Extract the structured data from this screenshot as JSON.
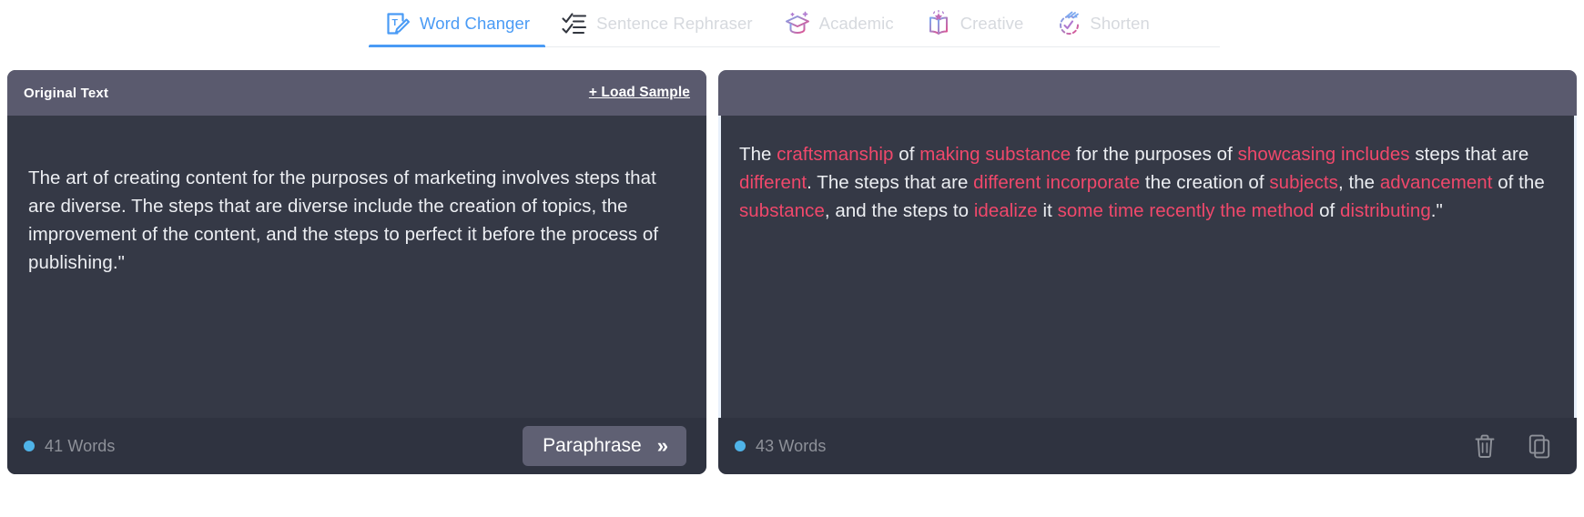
{
  "tabs": [
    {
      "id": "word-changer",
      "label": "Word Changer",
      "icon": "text-edit-icon",
      "active": true
    },
    {
      "id": "sentence-rephraser",
      "label": "Sentence Rephraser",
      "icon": "checklist-icon",
      "active": false
    },
    {
      "id": "academic",
      "label": "Academic",
      "icon": "graduation-cap-icon",
      "active": false
    },
    {
      "id": "creative",
      "label": "Creative",
      "icon": "open-book-icon",
      "active": false
    },
    {
      "id": "shorten",
      "label": "Shorten",
      "icon": "shorten-clock-icon",
      "active": false
    }
  ],
  "left_panel": {
    "title": "Original Text",
    "load_sample_label": "+ Load Sample",
    "text": "The art of creating content for the purposes of marketing involves steps that are diverse. The steps that are diverse include the creation of topics, the improvement of the content, and the steps to perfect it before the process of publishing.\"",
    "word_count": "41 Words",
    "paraphrase_label": "Paraphrase",
    "paraphrase_chevron": "»",
    "spinner_icon": "loading-spinner-icon"
  },
  "right_panel": {
    "title": "",
    "word_count": "43 Words",
    "delete_icon": "trash-icon",
    "copy_icon": "copy-icon",
    "segments": [
      {
        "t": "The ",
        "hl": false
      },
      {
        "t": "craftsmanship",
        "hl": true
      },
      {
        "t": " of ",
        "hl": false
      },
      {
        "t": "making substance",
        "hl": true
      },
      {
        "t": " for the purposes of ",
        "hl": false
      },
      {
        "t": "showcasing includes",
        "hl": true
      },
      {
        "t": " steps that are ",
        "hl": false
      },
      {
        "t": "different",
        "hl": true
      },
      {
        "t": ". The steps that are ",
        "hl": false
      },
      {
        "t": "different incorporate",
        "hl": true
      },
      {
        "t": " the creation of ",
        "hl": false
      },
      {
        "t": "subjects",
        "hl": true
      },
      {
        "t": ", the ",
        "hl": false
      },
      {
        "t": "advancement",
        "hl": true
      },
      {
        "t": " of the ",
        "hl": false
      },
      {
        "t": "substance",
        "hl": true
      },
      {
        "t": ", and the steps to ",
        "hl": false
      },
      {
        "t": "idealize",
        "hl": true
      },
      {
        "t": " it ",
        "hl": false
      },
      {
        "t": "some time recently the method",
        "hl": true
      },
      {
        "t": " of ",
        "hl": false
      },
      {
        "t": "distributing",
        "hl": true
      },
      {
        "t": ".\"",
        "hl": false
      }
    ]
  },
  "colors": {
    "accent_blue": "#4a9bf5",
    "highlight_pink": "#f0486b",
    "panel_bg": "#353946",
    "panel_head": "#5a5a6e",
    "footer_bg": "#2f3340",
    "teal": "#0f9b80"
  }
}
